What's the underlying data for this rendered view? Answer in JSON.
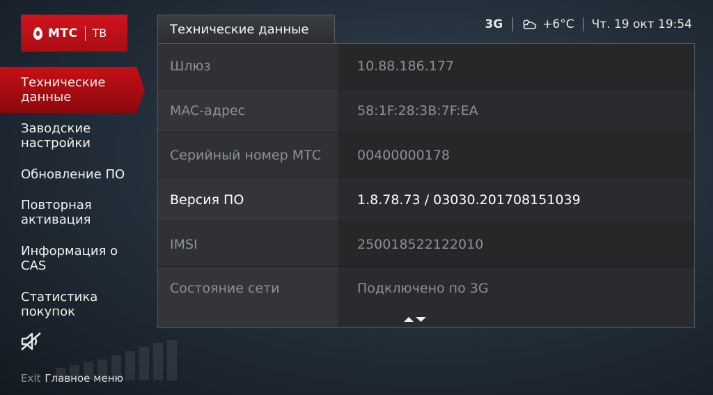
{
  "logo": {
    "brand": "МТС",
    "service": "ТВ"
  },
  "menu": {
    "items": [
      {
        "label": "Технические данные",
        "active": true
      },
      {
        "label": "Заводские настройки",
        "active": false
      },
      {
        "label": "Обновление ПО",
        "active": false
      },
      {
        "label": "Повторная активация",
        "active": false
      },
      {
        "label": "Информация о CAS",
        "active": false
      },
      {
        "label": "Статистика покупок",
        "active": false
      }
    ],
    "mute_icon": "muted-speaker-icon"
  },
  "footer": {
    "key": "Exit",
    "label": "Главное меню"
  },
  "status": {
    "network": "3G",
    "weather_icon": "partly-cloudy-icon",
    "temperature": "+6°C",
    "datetime": "Чт. 19 окт 19:54"
  },
  "panel": {
    "tab_title": "Технические данные",
    "rows": [
      {
        "key": "Шлюз",
        "value": "10.88.186.177"
      },
      {
        "key": "MAC-адрес",
        "value": "58:1F:28:3B:7F:EA"
      },
      {
        "key": "Серийный номер МТС",
        "value": "00400000178"
      },
      {
        "key": "Версия ПО",
        "value": "1.8.78.73 / 03030.201708151039"
      },
      {
        "key": "IMSI",
        "value": "250018522122010"
      },
      {
        "key": "Состояние сети",
        "value": "Подключено по 3G"
      }
    ],
    "selected_row": 3,
    "scroll_icon": "scroll-up-down-icon"
  },
  "colors": {
    "accent": "#c8101a",
    "panel": "#2a2c2f",
    "text_dim": "#8d9196"
  }
}
